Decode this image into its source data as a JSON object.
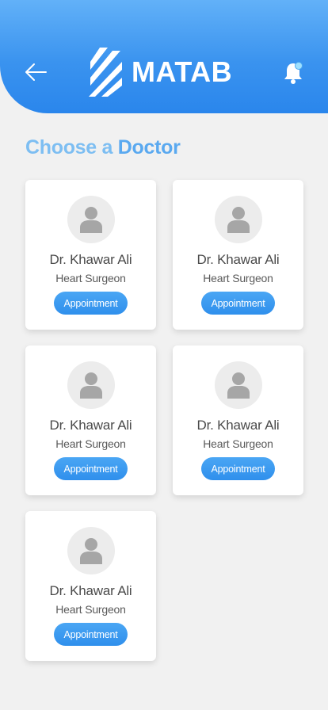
{
  "header": {
    "logo_text": "MATAB",
    "colors": {
      "gradient_top": "#62b1f8",
      "gradient_bottom": "#2a86ec"
    }
  },
  "page": {
    "title_prefix": "Choose a ",
    "title_emphasis": "Doctor"
  },
  "doctors": [
    {
      "name": "Dr. Khawar Ali",
      "specialty": "Heart Surgeon",
      "action": "Appointment"
    },
    {
      "name": "Dr. Khawar Ali",
      "specialty": "Heart Surgeon",
      "action": "Appointment"
    },
    {
      "name": "Dr. Khawar Ali",
      "specialty": "Heart Surgeon",
      "action": "Appointment"
    },
    {
      "name": "Dr. Khawar Ali",
      "specialty": "Heart Surgeon",
      "action": "Appointment"
    },
    {
      "name": "Dr. Khawar Ali",
      "specialty": "Heart Surgeon",
      "action": "Appointment"
    }
  ],
  "icons": [
    "back-arrow-icon",
    "logo-mark-icon",
    "bell-icon",
    "notification-dot",
    "user-placeholder-icon"
  ]
}
